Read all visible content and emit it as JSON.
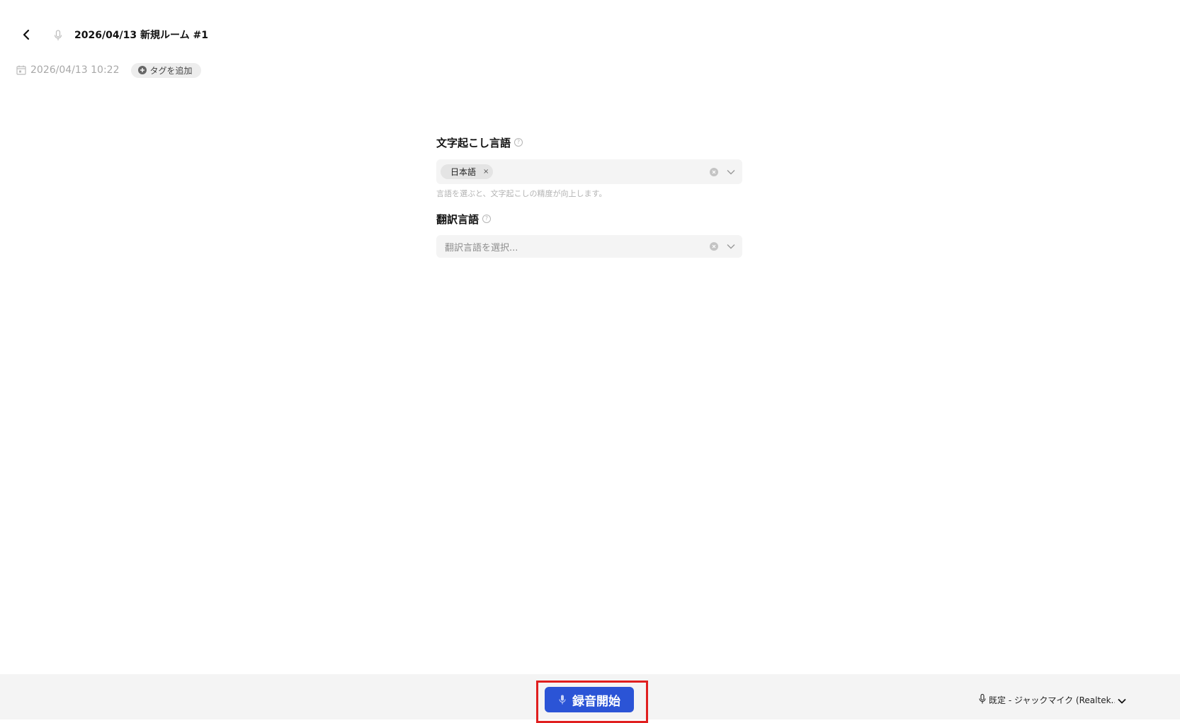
{
  "header": {
    "title": "2026/04/13 新規ルーム #1",
    "created_at": "2026/04/13 10:22",
    "tag_add_label": "タグを追加",
    "icons": {
      "back": "chevron-left-icon",
      "room_type": "microphone-icon",
      "date": "calendar-icon",
      "tag_add": "plus-circle-icon"
    }
  },
  "form": {
    "transcription": {
      "label": "文字起こし言語",
      "selected_chip": "日本語",
      "chip_remove": "×",
      "hint": "言語を選ぶと、文字起こしの精度が向上します。"
    },
    "translation": {
      "label": "翻訳言語",
      "placeholder": "翻訳言語を選択..."
    },
    "help_glyph": "?"
  },
  "bottom_bar": {
    "record_label": "録音開始",
    "device_label": "既定 - ジャックマイク (Realtek...",
    "accent_color": "#2b54d6",
    "highlight_color": "#e01f1f"
  }
}
